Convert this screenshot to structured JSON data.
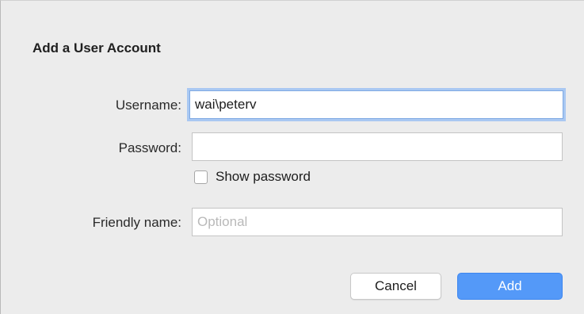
{
  "dialog": {
    "title": "Add a User Account"
  },
  "form": {
    "username": {
      "label": "Username:",
      "value": "wai\\peterv"
    },
    "password": {
      "label": "Password:",
      "value": ""
    },
    "show_password": {
      "label": "Show password",
      "checked": false
    },
    "friendly_name": {
      "label": "Friendly name:",
      "value": "",
      "placeholder": "Optional"
    }
  },
  "buttons": {
    "cancel_label": "Cancel",
    "add_label": "Add"
  },
  "colors": {
    "primary_button": "#5499f8",
    "focus_ring": "#a9c8f2",
    "background": "#ececec"
  }
}
